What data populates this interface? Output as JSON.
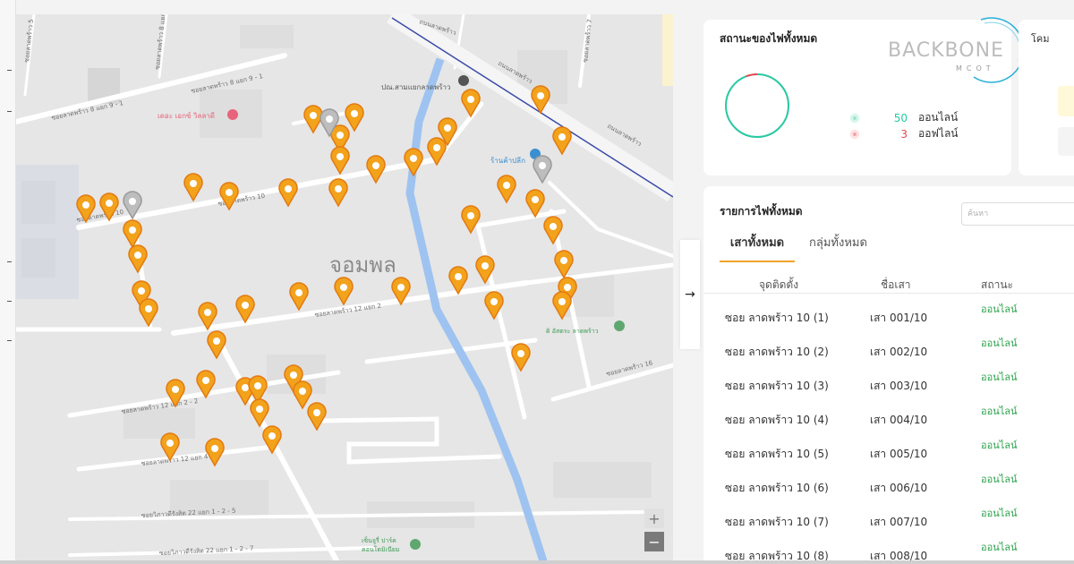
{
  "map": {
    "district_label": "จอมพล",
    "poi_bus": "ปณ.สามแยกลาดพร้าว",
    "poi_clinic": "เดอะ เอกซ์ วิลลาดี",
    "poi_shop": "ร้านค้าปลีก",
    "poi_temple": "ดิ อัสตระ ลาดพร้าว",
    "poi_school": "เซ็นจูรี่ ปาร์ค",
    "poi_school2": "คอนโดมิเนียม",
    "roads": [
      "ถนนลาดพร้าว",
      "ถนนลาดพร้าว",
      "ถนนลาดพร้าว",
      "ซอยลาดพร้าว 8 แยก 9 - 1",
      "ซอยลาดพร้าว 8 แยก 9 - 1",
      "ซอยลาดพร้าว 10",
      "ซอยลาดพร้าว 10",
      "ซอยลาดพร้าว 12 แยก 2",
      "ซอยลาดพร้าว 12 แยก 2 - 2",
      "ซอยลาดพร้าว 12 แยก 4",
      "ซอยลาดพร้าว 16",
      "ซอยวิภาวดีรังสิต 22 แยก 1 - 2 - 5",
      "ซอยวิภาวดีรังสิต 22 แยก 1 - 2 - 7",
      "ซอยลาดพร้าว 7",
      "ซอยลาดพร้าว 5",
      "ซอยลาดพร้าว 8 แยก 3"
    ],
    "zoom_in": "+",
    "zoom_out": "−"
  },
  "collapse_icon": "→",
  "status_card": {
    "title": "สถานะของไฟทั้งหมด",
    "online_count": "50",
    "online_label": "ออนไลน์",
    "offline_count": "3",
    "offline_label": "ออฟไลน์",
    "colors": {
      "online": "#28c9a3",
      "offline": "#e44650"
    },
    "donut": {
      "online": 50,
      "offline": 3
    }
  },
  "logo": {
    "text": "BACKBONE",
    "sub": "MCOT"
  },
  "side_card": {
    "label": "โคม"
  },
  "list_card": {
    "title": "รายการไฟทั้งหมด",
    "search_placeholder": "ค้นหา",
    "tabs": [
      "เสาทั้งหมด",
      "กลุ่มทั้งหมด"
    ],
    "headers": [
      "จุดติดตั้ง",
      "ชื่อเสา",
      "สถานะ"
    ],
    "rows": [
      {
        "location": "ซอย ลาดพร้าว 10 (1)",
        "name": "เสา 001/10",
        "status": "ออนไลน์"
      },
      {
        "location": "ซอย ลาดพร้าว 10 (2)",
        "name": "เสา 002/10",
        "status": "ออนไลน์"
      },
      {
        "location": "ซอย ลาดพร้าว 10 (3)",
        "name": "เสา 003/10",
        "status": "ออนไลน์"
      },
      {
        "location": "ซอย ลาดพร้าว 10 (4)",
        "name": "เสา 004/10",
        "status": "ออนไลน์"
      },
      {
        "location": "ซอย ลาดพร้าว 10 (5)",
        "name": "เสา 005/10",
        "status": "ออนไลน์"
      },
      {
        "location": "ซอย ลาดพร้าว 10 (6)",
        "name": "เสา 006/10",
        "status": "ออนไลน์"
      },
      {
        "location": "ซอย ลาดพร้าว 10 (7)",
        "name": "เสา 007/10",
        "status": "ออนไลน์"
      },
      {
        "location": "ซอย ลาดพร้าว 10 (8)",
        "name": "เสา 008/10",
        "status": "ออนไลน์"
      }
    ]
  }
}
